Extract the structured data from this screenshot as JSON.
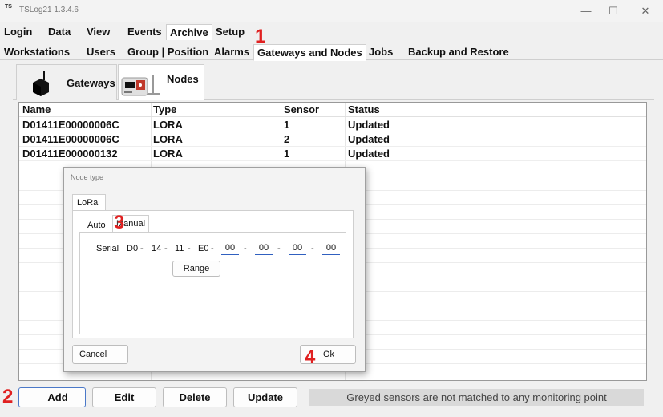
{
  "window": {
    "app_icon_text": "TS",
    "title": "TSLog21  1.3.4.6",
    "minimize": "—",
    "maximize": "☐",
    "close": "✕"
  },
  "menu": [
    "Login",
    "Data",
    "View",
    "Events",
    "Archive",
    "Setup"
  ],
  "archive_tabs": [
    "Workstations",
    "Users",
    "Group | Position",
    "Alarms",
    "Gateways and Nodes",
    "Jobs",
    "Backup and Restore"
  ],
  "subtabs": {
    "gateways": "Gateways",
    "nodes": "Nodes"
  },
  "grid": {
    "columns": [
      "Name",
      "Type",
      "Sensor",
      "Status"
    ],
    "rows": [
      [
        "D01411E00000006C",
        "LORA",
        "1",
        "Updated"
      ],
      [
        "D01411E00000006C",
        "LORA",
        "2",
        "Updated"
      ],
      [
        "D01411E000000132",
        "LORA",
        "1",
        "Updated"
      ]
    ]
  },
  "dialog": {
    "title": "Node type",
    "tab_lora": "LoRa",
    "tab_auto": "Auto",
    "tab_manual": "Manual",
    "serial_label": "Serial",
    "serial_fixed": [
      "D0",
      "14",
      "11",
      "E0"
    ],
    "serial_inputs": [
      "00",
      "00",
      "00",
      "00"
    ],
    "separator": "-",
    "range_button": "Range",
    "cancel_button": "Cancel",
    "ok_button": "Ok"
  },
  "bottom": {
    "add": "Add",
    "edit": "Edit",
    "delete": "Delete",
    "update": "Update",
    "status_text": "Greyed sensors are not matched to any monitoring point"
  },
  "annotations": [
    "1",
    "2",
    "3",
    "4"
  ],
  "colors": {
    "annotation": "#e02020",
    "input_underline": "#3060c0"
  }
}
